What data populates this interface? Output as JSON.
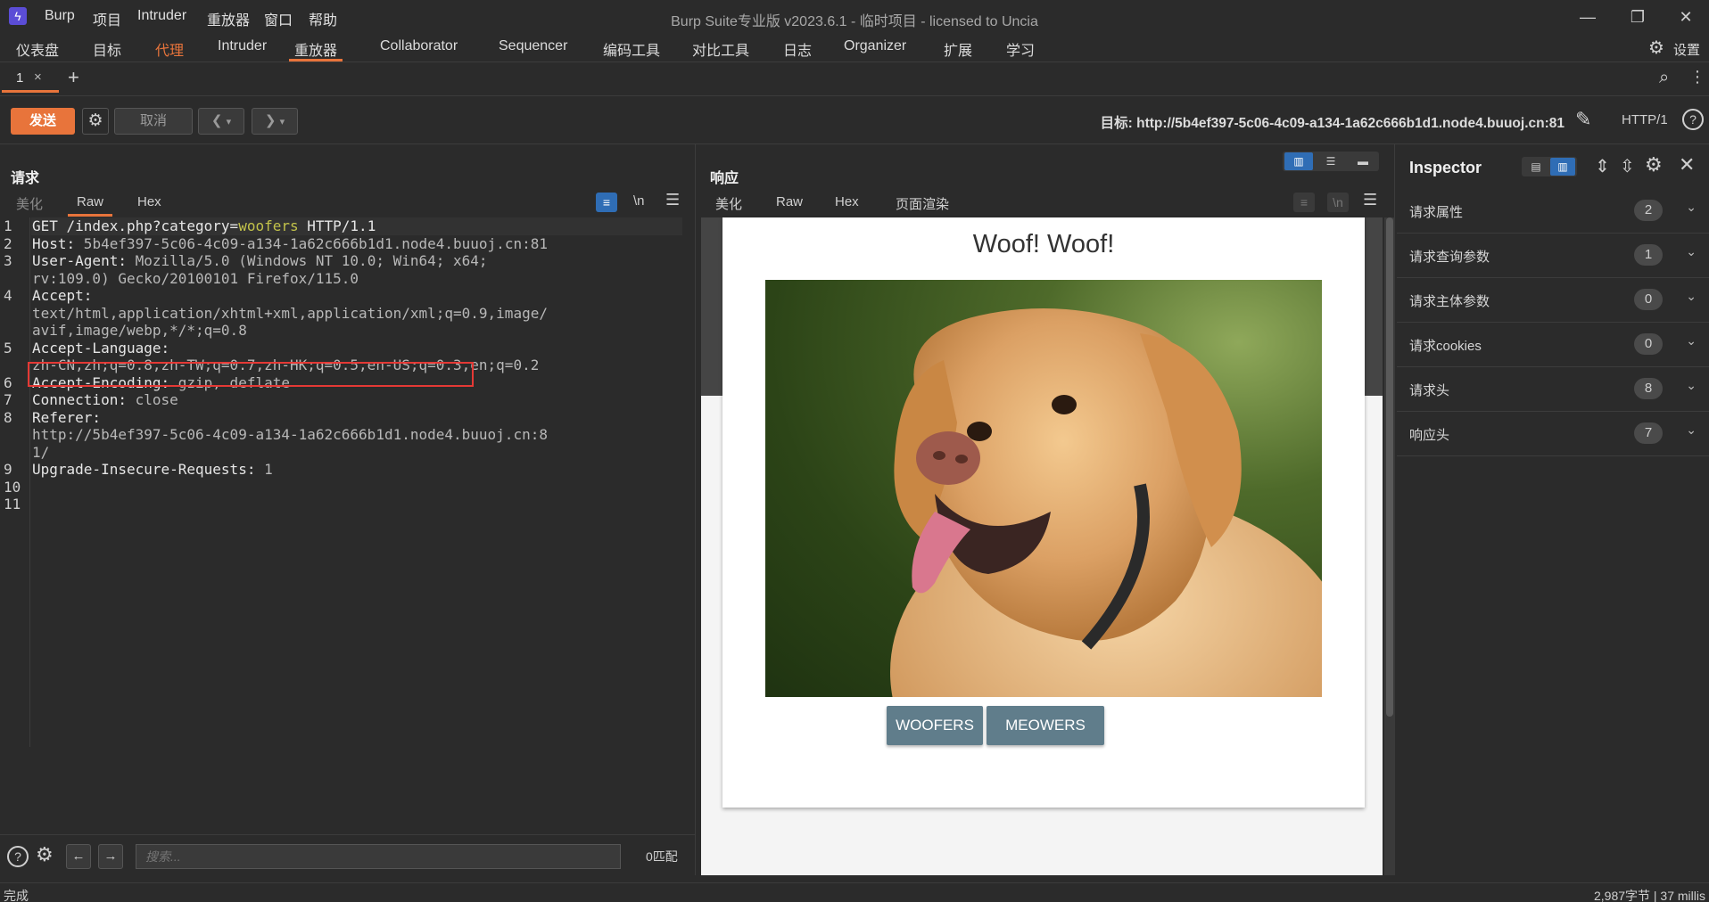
{
  "titlebar": {
    "menu": [
      "Burp",
      "项目",
      "Intruder",
      "重放器",
      "窗口",
      "帮助"
    ],
    "title": "Burp Suite专业版  v2023.6.1 - 临时项目 - licensed to Uncia"
  },
  "nav": {
    "tabs": [
      "仪表盘",
      "目标",
      "代理",
      "Intruder",
      "重放器",
      "Collaborator",
      "Sequencer",
      "编码工具",
      "对比工具",
      "日志",
      "Organizer",
      "扩展",
      "学习"
    ],
    "active": "重放器",
    "settings_label": "设置"
  },
  "subtabs": {
    "tab1_label": "1",
    "tab1_close": "×",
    "add": "+"
  },
  "toolbar": {
    "send_label": "发送",
    "cancel_label": "取消",
    "target_label": "目标: http://5b4ef397-5c06-4c09-a134-1a62c666b1d1.node4.buuoj.cn:81",
    "protocol": "HTTP/1"
  },
  "request": {
    "title": "请求",
    "tabs": [
      "美化",
      "Raw",
      "Hex"
    ],
    "active_tab": "Raw",
    "newline_label": "\\n",
    "lines": [
      {
        "num": "1",
        "name": "GET /index.php?category=",
        "value": "woofers",
        "rest": " HTTP/1.1"
      },
      {
        "num": "2",
        "name": "Host:",
        "value": " 5b4ef397-5c06-4c09-a134-1a62c666b1d1.node4.buuoj.cn:81"
      },
      {
        "num": "3",
        "name": "User-Agent:",
        "value": " Mozilla/5.0 (Windows NT 10.0; Win64; x64;",
        "cont": [
          "rv:109.0) Gecko/20100101 Firefox/115.0"
        ]
      },
      {
        "num": "4",
        "name": "Accept:",
        "value": "",
        "cont": [
          "text/html,application/xhtml+xml,application/xml;q=0.9,image/",
          "avif,image/webp,*/*;q=0.8"
        ]
      },
      {
        "num": "5",
        "name": "Accept-Language:",
        "value": "",
        "cont": [
          "zh-CN,zh;q=0.8,zh-TW;q=0.7,zh-HK;q=0.5,en-US;q=0.3,en;q=0.2"
        ]
      },
      {
        "num": "6",
        "name": "Accept-Encoding:",
        "value": " gzip, deflate"
      },
      {
        "num": "7",
        "name": "Connection:",
        "value": " close"
      },
      {
        "num": "8",
        "name": "Referer:",
        "value": "",
        "cont": [
          "http://5b4ef397-5c06-4c09-a134-1a62c666b1d1.node4.buuoj.cn:8",
          "1/"
        ]
      },
      {
        "num": "9",
        "name": "Upgrade-Insecure-Requests:",
        "value": " 1"
      },
      {
        "num": "10",
        "name": "",
        "value": ""
      },
      {
        "num": "11",
        "name": "",
        "value": ""
      }
    ],
    "search_placeholder": "搜索...",
    "match_count": "0匹配"
  },
  "response": {
    "title": "响应",
    "tabs": [
      "美化",
      "Raw",
      "Hex",
      "页面渲染"
    ],
    "active_tab": "页面渲染",
    "newline_label": "\\n",
    "page": {
      "heading": "Woof! Woof!",
      "buttons": [
        "WOOFERS",
        "MEOWERS"
      ]
    }
  },
  "inspector": {
    "title": "Inspector",
    "rows": [
      {
        "label": "请求属性",
        "count": "2"
      },
      {
        "label": "请求查询参数",
        "count": "1"
      },
      {
        "label": "请求主体参数",
        "count": "0"
      },
      {
        "label": "请求cookies",
        "count": "0"
      },
      {
        "label": "请求头",
        "count": "8"
      },
      {
        "label": "响应头",
        "count": "7"
      }
    ]
  },
  "status": {
    "left": "完成",
    "right": "2,987字节 | 37 millis"
  },
  "colors": {
    "accent": "#e8743b",
    "send_button": "#e8743b",
    "param_value": "#c2c24a",
    "highlight_box": "#e53935",
    "render_button": "#607d8b"
  }
}
